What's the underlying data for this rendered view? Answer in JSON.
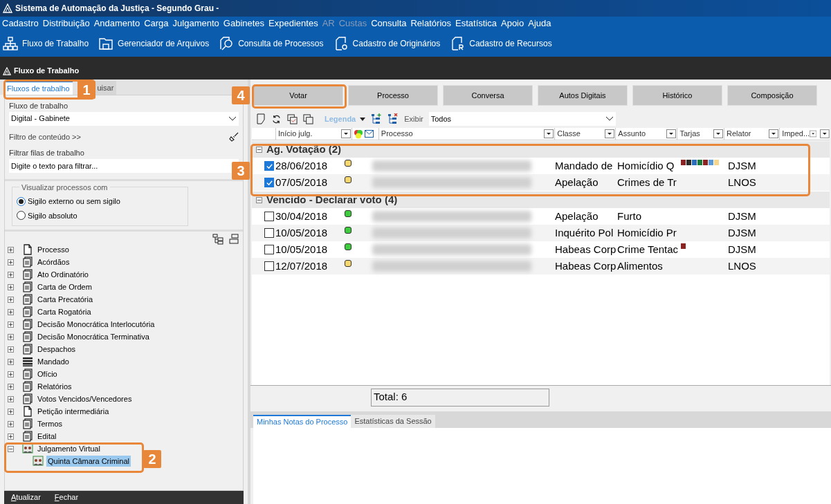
{
  "window": {
    "title": "Sistema de Automação da Justiça - Segundo Grau -"
  },
  "menu": [
    {
      "label": "Cadastro",
      "disabled": false
    },
    {
      "label": "Distribuição",
      "disabled": false
    },
    {
      "label": "Andamento",
      "disabled": false
    },
    {
      "label": "Carga",
      "disabled": false
    },
    {
      "label": "Julgamento",
      "disabled": false
    },
    {
      "label": "Gabinetes",
      "disabled": false
    },
    {
      "label": "Expedientes",
      "disabled": false
    },
    {
      "label": "AR",
      "disabled": true
    },
    {
      "label": "Custas",
      "disabled": true
    },
    {
      "label": "Consulta",
      "disabled": false
    },
    {
      "label": "Relatórios",
      "disabled": false
    },
    {
      "label": "Estatística",
      "disabled": false
    },
    {
      "label": "Apoio",
      "disabled": false
    },
    {
      "label": "Ajuda",
      "disabled": false
    }
  ],
  "toolbar": [
    {
      "label": "Fluxo de Trabalho",
      "kind": "hierarchy"
    },
    {
      "label": "Gerenciador de Arquivos",
      "kind": "folder"
    },
    {
      "label": "Consulta de Processos",
      "kind": "search"
    },
    {
      "label": "Cadastro de Originários",
      "kind": "doc-o"
    },
    {
      "label": "Cadastro de Recursos",
      "kind": "doc-r"
    }
  ],
  "panel": {
    "title": "Fluxo de Trabalho"
  },
  "left": {
    "tabs": [
      {
        "label": "Fluxos de trabalho",
        "selected": true
      },
      {
        "label": "uisar",
        "selected": false
      }
    ],
    "workflow_label": "Fluxo de trabalho",
    "workflow_value": "Digital - Gabinete",
    "content_filter": "Filtro de conteúdo >>",
    "queue_filter_label": "Filtrar filas de trabalho",
    "queue_filter_placeholder": "Digite o texto para filtrar...",
    "visibility": {
      "legend": "Visualizar processos com",
      "options": [
        {
          "label": "Sigilo externo ou sem sigilo",
          "selected": true
        },
        {
          "label": "Sigilo absoluto",
          "selected": false
        }
      ]
    },
    "tree": [
      {
        "label": "Processo",
        "kind": "page",
        "expanded": false,
        "selected": false
      },
      {
        "label": "Acórdãos",
        "kind": "clipboard",
        "expanded": false,
        "selected": false
      },
      {
        "label": "Ato Ordinatório",
        "kind": "clipboard",
        "expanded": false,
        "selected": false
      },
      {
        "label": "Carta de Ordem",
        "kind": "clipboard",
        "expanded": false,
        "selected": false
      },
      {
        "label": "Carta Precatória",
        "kind": "clipboard",
        "expanded": false,
        "selected": false
      },
      {
        "label": "Carta Rogatória",
        "kind": "clipboard",
        "expanded": false,
        "selected": false
      },
      {
        "label": "Decisão Monocrática Interlocutória",
        "kind": "clipboard",
        "expanded": false,
        "selected": false
      },
      {
        "label": "Decisão Monocrática Terminativa",
        "kind": "clipboard",
        "expanded": false,
        "selected": false
      },
      {
        "label": "Despachos",
        "kind": "clipboard",
        "expanded": false,
        "selected": false
      },
      {
        "label": "Mandado",
        "kind": "list",
        "expanded": false,
        "selected": false
      },
      {
        "label": "Ofício",
        "kind": "clipboard",
        "expanded": false,
        "selected": false
      },
      {
        "label": "Relatórios",
        "kind": "clipboard",
        "expanded": false,
        "selected": false
      },
      {
        "label": "Votos Vencidos/Vencedores",
        "kind": "clipboard",
        "expanded": false,
        "selected": false
      },
      {
        "label": "Petição intermediária",
        "kind": "page",
        "expanded": false,
        "selected": false
      },
      {
        "label": "Termos",
        "kind": "clipboard",
        "expanded": false,
        "selected": false
      },
      {
        "label": "Edital",
        "kind": "clipboard",
        "expanded": false,
        "selected": false
      },
      {
        "label": "Julgamento Virtual",
        "kind": "people",
        "expanded": true,
        "selected": false,
        "children": [
          {
            "label": "Quinta Câmara Criminal",
            "kind": "people",
            "selected": true
          }
        ]
      }
    ],
    "buttons": [
      "Atualizar",
      "Fechar"
    ]
  },
  "right": {
    "actions": [
      "Votar",
      "Processo",
      "Conversa",
      "Autos Digitais",
      "Histórico",
      "Composição"
    ],
    "legend": "Legenda",
    "show_label": "Exibir",
    "show_value": "Todos",
    "columns": [
      "Início julg.",
      "Processo",
      "Classe",
      "Assunto",
      "Tarjas",
      "Relator",
      "Imped..."
    ],
    "groups": [
      {
        "title": "Ag. Votação (2)",
        "expanded": true,
        "rows": [
          {
            "checked": true,
            "date": "28/06/2018",
            "color": "#f5d76e",
            "classe": "Mandado de",
            "assunto": "Homicídio Q",
            "tarjas": [
              {
                "color": "#8b2323"
              },
              {
                "color": "#2b2b2b"
              },
              {
                "color": "#2a6ebd"
              },
              {
                "color": "#1a7a3a"
              },
              {
                "color": "#8b2323"
              },
              {
                "color": "#5b9bd5"
              },
              {
                "color": "#f5d78e"
              }
            ],
            "relator": "DJSM"
          },
          {
            "checked": true,
            "date": "07/05/2018",
            "color": "#f5d76e",
            "classe": "Apelação",
            "assunto": "Crimes de Tr",
            "tarjas": [],
            "relator": "LNOS"
          }
        ]
      },
      {
        "title": "Vencido - Declarar voto (4)",
        "expanded": true,
        "rows": [
          {
            "checked": false,
            "date": "30/04/2018",
            "color": "#3ccc3c",
            "classe": "Apelação",
            "assunto": "Furto",
            "tarjas": [],
            "relator": "DJSM"
          },
          {
            "checked": false,
            "date": "10/05/2018",
            "color": "#3ccc3c",
            "classe": "Inquérito Pol",
            "assunto": "Homicídio Pr",
            "tarjas": [],
            "relator": "DJSM"
          },
          {
            "checked": false,
            "date": "10/05/2018",
            "color": "#3ccc3c",
            "classe": "Habeas Corp",
            "assunto": "Crime Tentac",
            "tarjas": [
              {
                "color": "#8b2323"
              }
            ],
            "relator": "DJSM"
          },
          {
            "checked": false,
            "date": "12/07/2018",
            "color": "#f5d76e",
            "classe": "Habeas Corp",
            "assunto": "Alimentos",
            "tarjas": [],
            "relator": "LNOS"
          }
        ]
      }
    ],
    "total": "Total: 6",
    "bottom_tabs": [
      {
        "label": "Minhas Notas do Processo",
        "selected": true
      },
      {
        "label": "Estatísticas da Sessão",
        "selected": false
      }
    ]
  },
  "callouts": [
    "1",
    "2",
    "3",
    "4"
  ]
}
